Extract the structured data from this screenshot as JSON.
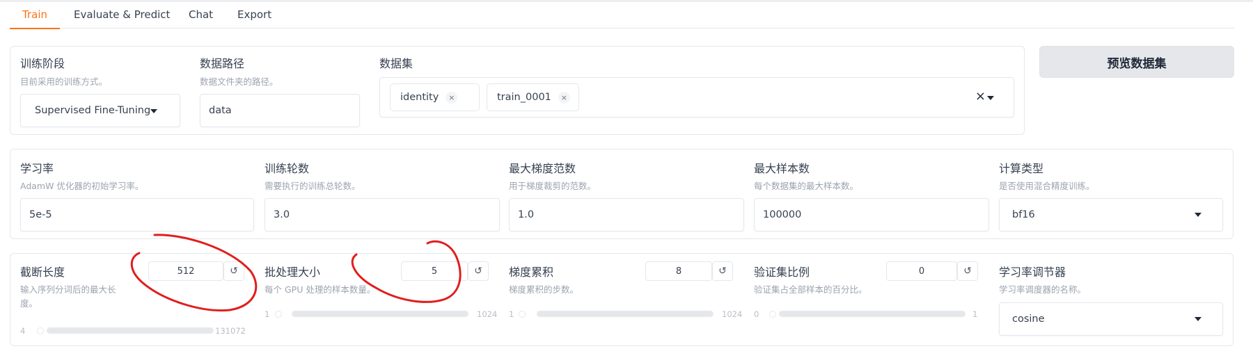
{
  "tabs": [
    "Train",
    "Evaluate & Predict",
    "Chat",
    "Export"
  ],
  "stage": {
    "label": "训练阶段",
    "info": "目前采用的训练方式。",
    "value": "Supervised Fine-Tuning"
  },
  "data_dir": {
    "label": "数据路径",
    "info": "数据文件夹的路径。",
    "value": "data"
  },
  "dataset": {
    "label": "数据集",
    "chips": [
      "identity",
      "train_0001"
    ],
    "clear_glyph": "×"
  },
  "preview_button": "预览数据集",
  "learning_rate": {
    "label": "学习率",
    "info": "AdamW 优化器的初始学习率。",
    "value": "5e-5"
  },
  "epochs": {
    "label": "训练轮数",
    "info": "需要执行的训练总轮数。",
    "value": "3.0"
  },
  "max_grad_norm": {
    "label": "最大梯度范数",
    "info": "用于梯度裁剪的范数。",
    "value": "1.0"
  },
  "max_samples": {
    "label": "最大样本数",
    "info": "每个数据集的最大样本数。",
    "value": "100000"
  },
  "compute_type": {
    "label": "计算类型",
    "info": "是否使用混合精度训练。",
    "value": "bf16"
  },
  "cutoff_len": {
    "label": "截断长度",
    "info_line1": "输入序列分词后的最大长",
    "info_line2": "度。",
    "value": "512",
    "min": "4",
    "max": "131072"
  },
  "batch_size": {
    "label": "批处理大小",
    "info": "每个 GPU 处理的样本数量。",
    "value": "5",
    "min": "1",
    "max": "1024"
  },
  "grad_accum": {
    "label": "梯度累积",
    "info": "梯度累积的步数。",
    "value": "8",
    "min": "1",
    "max": "1024"
  },
  "val_size": {
    "label": "验证集比例",
    "info": "验证集占全部样本的百分比。",
    "value": "0",
    "min": "0",
    "max": "1"
  },
  "lr_scheduler": {
    "label": "学习率调节器",
    "info": "学习率调度器的名称。",
    "value": "cosine"
  },
  "reset_glyph": "↺",
  "colors": {
    "accent": "#f97316",
    "annotation": "#e11d1d"
  }
}
